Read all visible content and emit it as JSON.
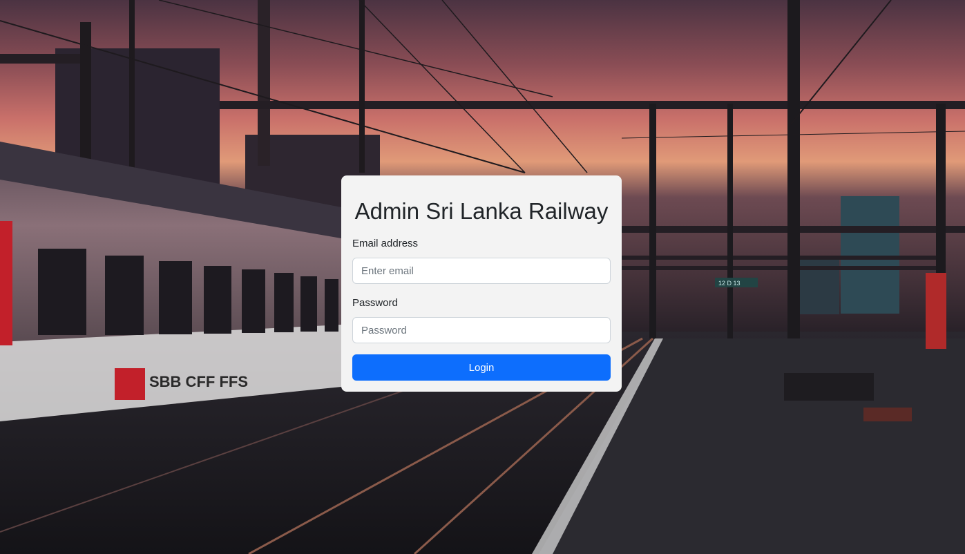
{
  "login_form": {
    "title": "Admin Sri Lanka Railway",
    "email_label": "Email address",
    "email_placeholder": "Enter email",
    "email_value": "",
    "password_label": "Password",
    "password_placeholder": "Password",
    "password_value": "",
    "submit_label": "Login"
  },
  "background": {
    "train_logo_text": "SBB CFF FFS",
    "platform_sign_text": "12 D 13"
  },
  "colors": {
    "button": "#0d6efd",
    "card": "#f3f3f3",
    "sky_top": "#5a3e52",
    "sky_glow": "#e8906a"
  }
}
